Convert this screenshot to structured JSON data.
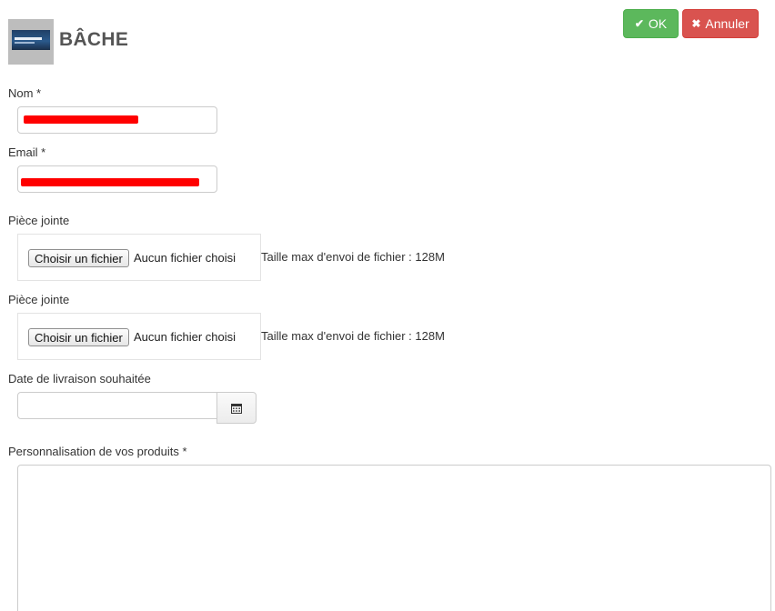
{
  "header": {
    "title": "BÂCHE",
    "thumbnail_icon": "product-thumbnail-icon"
  },
  "actions": {
    "ok_label": "OK",
    "ok_icon": "check-icon",
    "cancel_label": "Annuler",
    "cancel_icon": "close-icon",
    "ok_color": "#5cb85c",
    "cancel_color": "#d9534f"
  },
  "form": {
    "name": {
      "label": "Nom *",
      "value_redacted": true
    },
    "email": {
      "label": "Email *",
      "value_redacted": true
    },
    "attachments": [
      {
        "label": "Pièce jointe",
        "button_label": "Choisir un fichier",
        "status": "Aucun fichier choisi",
        "hint": "Taille max d'envoi de fichier : 128M"
      },
      {
        "label": "Pièce jointe",
        "button_label": "Choisir un fichier",
        "status": "Aucun fichier choisi",
        "hint": "Taille max d'envoi de fichier : 128M"
      }
    ],
    "delivery_date": {
      "label": "Date de livraison souhaitée",
      "value": "",
      "icon": "calendar-icon"
    },
    "customization": {
      "label": "Personnalisation de vos produits *",
      "value": ""
    }
  }
}
